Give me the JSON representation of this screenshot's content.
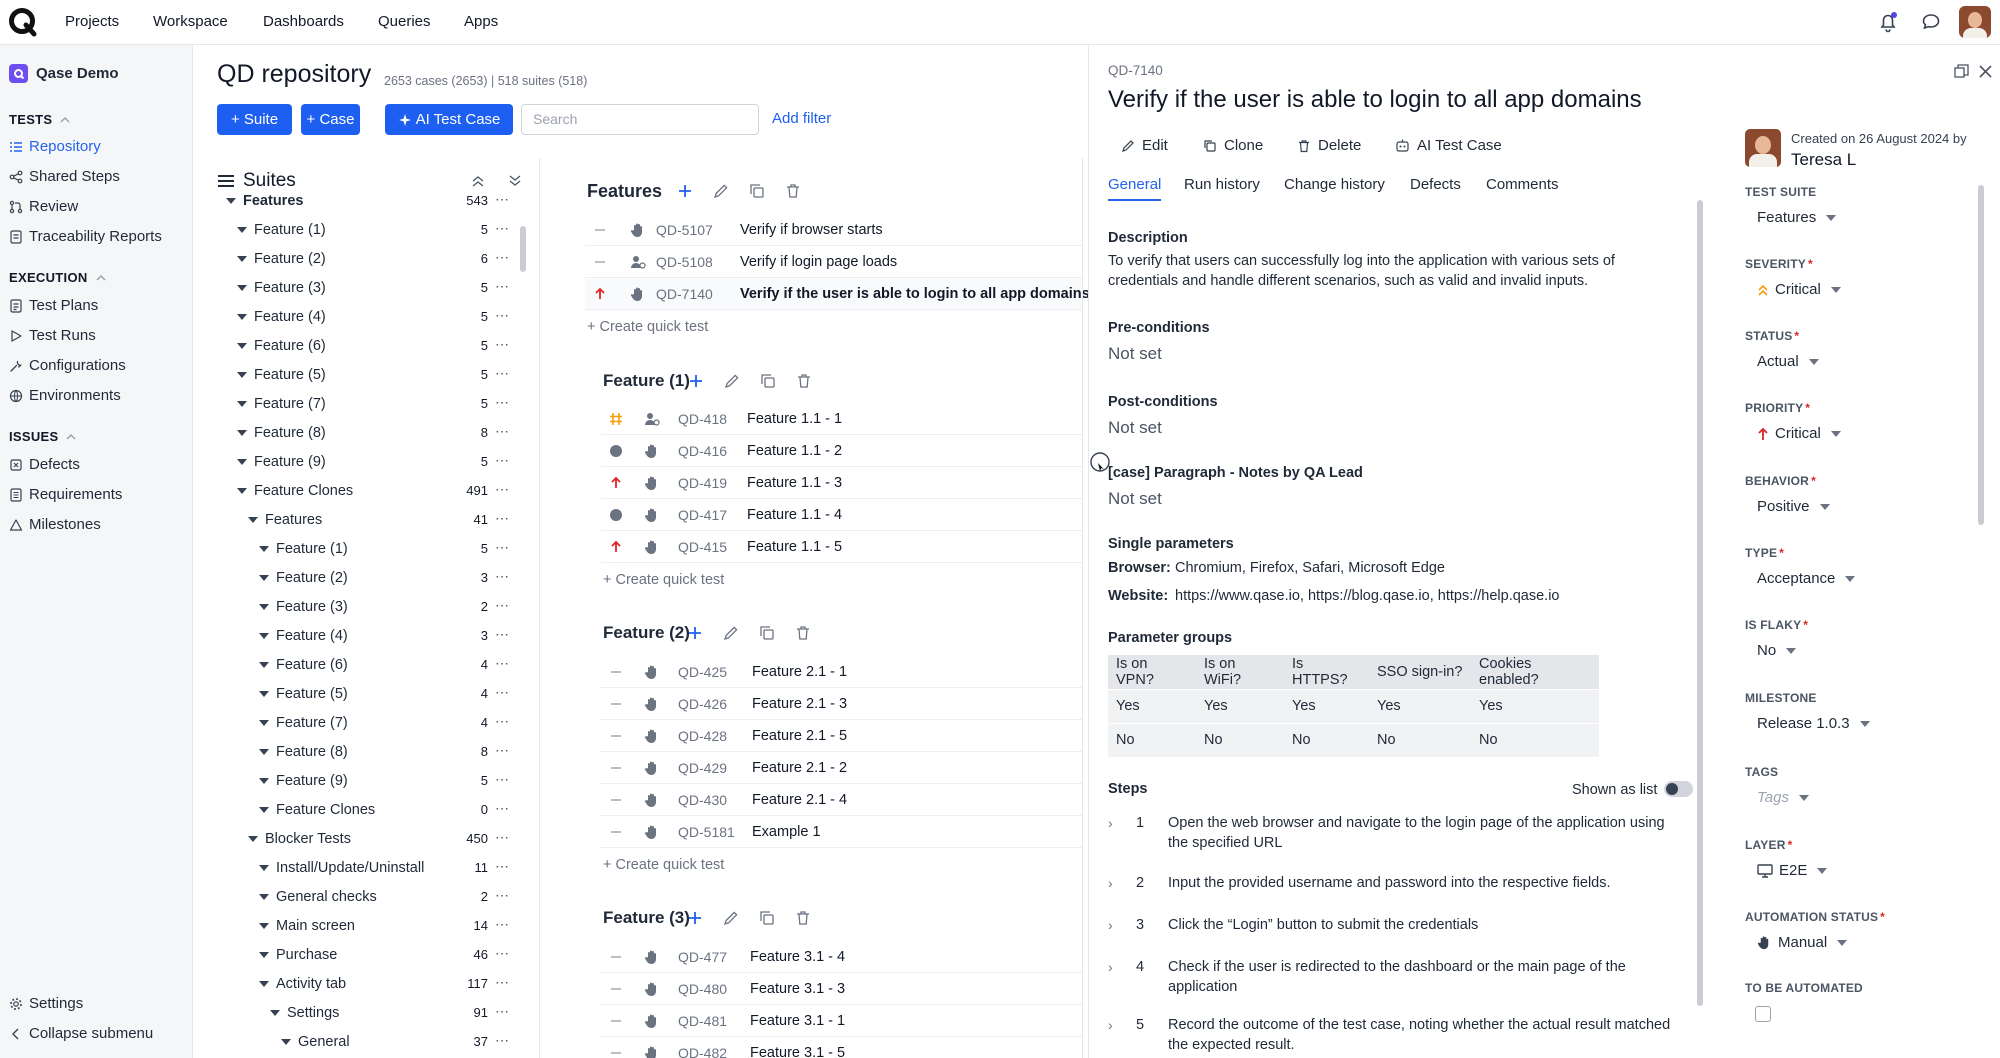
{
  "topbar": {
    "nav": [
      "Projects",
      "Workspace",
      "Dashboards",
      "Queries",
      "Apps"
    ]
  },
  "sidebar": {
    "project": "Qase Demo",
    "sections": {
      "tests": "TESTS",
      "execution": "EXECUTION",
      "issues": "ISSUES"
    },
    "tests_items": [
      "Repository",
      "Shared Steps",
      "Review",
      "Traceability Reports"
    ],
    "execution_items": [
      "Test Plans",
      "Test Runs",
      "Configurations",
      "Environments"
    ],
    "issues_items": [
      "Defects",
      "Requirements",
      "Milestones"
    ],
    "settings": "Settings",
    "collapse": "Collapse submenu"
  },
  "repo": {
    "title": "QD repository",
    "meta": "2653 cases (2653) | 518 suites (518)",
    "btn_suite": "+ Suite",
    "btn_case": "+ Case",
    "btn_ai": "AI Test Case",
    "search_placeholder": "Search",
    "add_filter": "Add filter"
  },
  "suites": {
    "heading": "Suites",
    "tree": [
      {
        "label": "Features",
        "count": "543",
        "level": 0
      },
      {
        "label": "Feature (1)",
        "count": "5",
        "level": 1
      },
      {
        "label": "Feature (2)",
        "count": "6",
        "level": 1
      },
      {
        "label": "Feature (3)",
        "count": "5",
        "level": 1
      },
      {
        "label": "Feature (4)",
        "count": "5",
        "level": 1
      },
      {
        "label": "Feature (6)",
        "count": "5",
        "level": 1
      },
      {
        "label": "Feature (5)",
        "count": "5",
        "level": 1
      },
      {
        "label": "Feature (7)",
        "count": "5",
        "level": 1
      },
      {
        "label": "Feature (8)",
        "count": "8",
        "level": 1
      },
      {
        "label": "Feature (9)",
        "count": "5",
        "level": 1
      },
      {
        "label": "Feature Clones",
        "count": "491",
        "level": 1
      },
      {
        "label": "Features",
        "count": "41",
        "level": 2
      },
      {
        "label": "Feature (1)",
        "count": "5",
        "level": 3
      },
      {
        "label": "Feature (2)",
        "count": "3",
        "level": 3
      },
      {
        "label": "Feature (3)",
        "count": "2",
        "level": 3
      },
      {
        "label": "Feature (4)",
        "count": "3",
        "level": 3
      },
      {
        "label": "Feature (6)",
        "count": "4",
        "level": 3
      },
      {
        "label": "Feature (5)",
        "count": "4",
        "level": 3
      },
      {
        "label": "Feature (7)",
        "count": "4",
        "level": 3
      },
      {
        "label": "Feature (8)",
        "count": "8",
        "level": 3
      },
      {
        "label": "Feature (9)",
        "count": "5",
        "level": 3
      },
      {
        "label": "Feature Clones",
        "count": "0",
        "level": 3
      },
      {
        "label": "Blocker Tests",
        "count": "450",
        "level": 2
      },
      {
        "label": "Install/Update/Uninstall",
        "count": "11",
        "level": 3
      },
      {
        "label": "General checks",
        "count": "2",
        "level": 3
      },
      {
        "label": "Main screen",
        "count": "14",
        "level": 3
      },
      {
        "label": "Purchase",
        "count": "46",
        "level": 3
      },
      {
        "label": "Activity tab",
        "count": "117",
        "level": 3
      },
      {
        "label": "Settings",
        "count": "91",
        "level": 4
      },
      {
        "label": "General",
        "count": "37",
        "level": 5
      }
    ]
  },
  "cases": {
    "quick_label": "+ Create quick test",
    "sections": [
      {
        "title": "Features",
        "rows": [
          {
            "id": "QD-5107",
            "title": "Verify if browser starts",
            "priority": "none",
            "auto": "manual"
          },
          {
            "id": "QD-5108",
            "title": "Verify if login page loads",
            "priority": "none",
            "auto": "to-be"
          },
          {
            "id": "QD-7140",
            "title": "Verify if the user is able to login to all app domains",
            "priority": "high",
            "auto": "manual",
            "selected": true
          }
        ]
      },
      {
        "title": "Feature (1)",
        "rows": [
          {
            "id": "QD-418",
            "title": "Feature 1.1 - 1",
            "priority": "hash",
            "auto": "to-be"
          },
          {
            "id": "QD-416",
            "title": "Feature 1.1 - 2",
            "priority": "dot",
            "auto": "manual"
          },
          {
            "id": "QD-419",
            "title": "Feature 1.1 - 3",
            "priority": "high",
            "auto": "manual"
          },
          {
            "id": "QD-417",
            "title": "Feature 1.1 - 4",
            "priority": "dot",
            "auto": "manual"
          },
          {
            "id": "QD-415",
            "title": "Feature 1.1 - 5",
            "priority": "high",
            "auto": "manual"
          }
        ]
      },
      {
        "title": "Feature (2)",
        "rows": [
          {
            "id": "QD-425",
            "title": "Feature 2.1 - 1",
            "priority": "none",
            "auto": "manual"
          },
          {
            "id": "QD-426",
            "title": "Feature 2.1 - 3",
            "priority": "none",
            "auto": "manual"
          },
          {
            "id": "QD-428",
            "title": "Feature 2.1 - 5",
            "priority": "none",
            "auto": "manual"
          },
          {
            "id": "QD-429",
            "title": "Feature 2.1 - 2",
            "priority": "none",
            "auto": "manual"
          },
          {
            "id": "QD-430",
            "title": "Feature 2.1 - 4",
            "priority": "none",
            "auto": "manual"
          },
          {
            "id": "QD-5181",
            "title": "Example 1",
            "priority": "none",
            "auto": "manual"
          }
        ]
      },
      {
        "title": "Feature (3)",
        "rows": [
          {
            "id": "QD-477",
            "title": "Feature 3.1 - 4",
            "priority": "none",
            "auto": "manual"
          },
          {
            "id": "QD-480",
            "title": "Feature 3.1 - 3",
            "priority": "none",
            "auto": "manual"
          },
          {
            "id": "QD-481",
            "title": "Feature 3.1 - 1",
            "priority": "none",
            "auto": "manual"
          },
          {
            "id": "QD-482",
            "title": "Feature 3.1 - 5",
            "priority": "none",
            "auto": "manual"
          }
        ]
      }
    ]
  },
  "detail": {
    "key": "QD-7140",
    "title": "Verify if the user is able to login to all app domains",
    "actions": {
      "edit": "Edit",
      "clone": "Clone",
      "delete": "Delete",
      "ai": "AI Test Case"
    },
    "tabs": [
      "General",
      "Run history",
      "Change history",
      "Defects",
      "Comments"
    ],
    "description_label": "Description",
    "description": "To verify that users can successfully log into the application with various sets of credentials and handle different scenarios, such as valid and invalid inputs.",
    "preconditions_label": "Pre-conditions",
    "preconditions": "Not set",
    "postconditions_label": "Post-conditions",
    "postconditions": "Not set",
    "notes_label": "[case] Paragraph - Notes by QA Lead",
    "notes": "Not set",
    "single_params_label": "Single parameters",
    "browser_label": "Browser:",
    "browser_value": "Chromium, Firefox, Safari, Microsoft Edge",
    "website_label": "Website:",
    "website_value": "https://www.qase.io, https://blog.qase.io, https://help.qase.io",
    "param_groups_label": "Parameter groups",
    "param_headers": [
      "Is on VPN?",
      "Is on WiFi?",
      "Is HTTPS?",
      "SSO sign-in?",
      "Cookies enabled?"
    ],
    "param_rows": [
      [
        "Yes",
        "Yes",
        "Yes",
        "Yes",
        "Yes"
      ],
      [
        "No",
        "No",
        "No",
        "No",
        "No"
      ]
    ],
    "steps_label": "Steps",
    "shown_as_list": "Shown as list",
    "steps": [
      {
        "n": "1",
        "text": "Open the web browser and navigate to the login page of the application using the specified URL"
      },
      {
        "n": "2",
        "text": "Input the provided username and password into the respective fields."
      },
      {
        "n": "3",
        "text": "Click the “Login” button to submit the credentials"
      },
      {
        "n": "4",
        "text": "Check if the user is redirected to the dashboard or the main page of the application"
      },
      {
        "n": "5",
        "text": "Record the outcome of the test case, noting whether the actual result matched the expected result."
      }
    ]
  },
  "props": {
    "created_on": "Created on 26 August 2024 by",
    "author": "Teresa L",
    "test_suite_label": "TEST SUITE",
    "test_suite": "Features",
    "severity_label": "SEVERITY",
    "severity": "Critical",
    "status_label": "STATUS",
    "status": "Actual",
    "priority_label": "PRIORITY",
    "priority": "Critical",
    "behavior_label": "BEHAVIOR",
    "behavior": "Positive",
    "type_label": "TYPE",
    "type": "Acceptance",
    "flaky_label": "IS FLAKY",
    "flaky": "No",
    "milestone_label": "MILESTONE",
    "milestone": "Release 1.0.3",
    "tags_label": "TAGS",
    "tags_placeholder": "Tags",
    "layer_label": "LAYER",
    "layer": "E2E",
    "automation_label": "AUTOMATION STATUS",
    "automation": "Manual",
    "to_be_automated_label": "TO BE AUTOMATED",
    "required_mark": "*"
  },
  "colors": {
    "accent": "#1d5ff0",
    "priority_high": "#dc2626",
    "hash": "#f59e0b"
  }
}
